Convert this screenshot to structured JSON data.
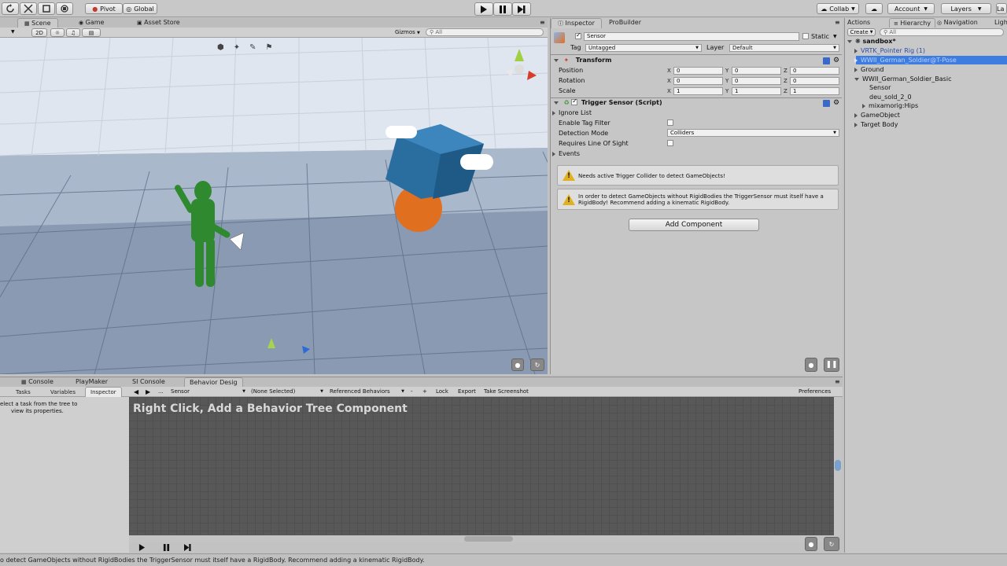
{
  "toolbar": {
    "pivot": "Pivot",
    "global": "Global",
    "collab": "Collab",
    "account": "Account",
    "layers": "Layers",
    "layout_cut": "La"
  },
  "scene_tabs": {
    "scene": "Scene",
    "game": "Game",
    "asset_store": "Asset Store",
    "mode_2d": "2D",
    "gizmos": "Gizmos",
    "search": "All"
  },
  "inspector_tabs": {
    "inspector": "Inspector",
    "probuilder": "ProBuilder"
  },
  "inspector": {
    "object_name": "Sensor",
    "static": "Static",
    "tag_label": "Tag",
    "tag_value": "Untagged",
    "layer_label": "Layer",
    "layer_value": "Default",
    "transform": {
      "title": "Transform",
      "position_label": "Position",
      "rotation_label": "Rotation",
      "scale_label": "Scale",
      "x": "X",
      "y": "Y",
      "z": "Z",
      "position": [
        "0",
        "0",
        "0"
      ],
      "rotation": [
        "0",
        "0",
        "0"
      ],
      "scale": [
        "1",
        "1",
        "1"
      ]
    },
    "trigger": {
      "title": "Trigger Sensor (Script)",
      "ignore_list": "Ignore List",
      "enable_tag_filter": "Enable Tag Filter",
      "detection_mode_label": "Detection Mode",
      "detection_mode_value": "Colliders",
      "requires_los": "Requires Line Of Sight",
      "events": "Events"
    },
    "warning1": "Needs active Trigger Collider to detect GameObjects!",
    "warning2": "In order to detect GameObjects without RigidBodies the TriggerSensor must itself have a RigidBody! Recommend adding a kinematic RigidBody.",
    "add_component": "Add Component"
  },
  "right_tabs": {
    "actions": "Actions",
    "hierarchy": "Hierarchy",
    "navigation": "Navigation",
    "lighting_cut": "Ligh",
    "create": "Create",
    "search": "All"
  },
  "hierarchy": {
    "scene": "sandbox*",
    "items": [
      "VRTK_Pointer Rig (1)",
      "WWII_German_Soldier@T-Pose",
      "Ground",
      "WWII_German_Soldier_Basic",
      "Sensor",
      "deu_sold_2_0",
      "mixamorig:Hips",
      "GameObject",
      "Target Body"
    ]
  },
  "bottom_tabs": {
    "console": "Console",
    "playmaker": "PlayMaker",
    "si_console": "SI Console",
    "behavior": "Behavior Desig"
  },
  "behavior": {
    "tasks": "Tasks",
    "variables": "Variables",
    "inspector": "Inspector",
    "dots": "...",
    "sensor": "Sensor",
    "none_selected": "(None Selected)",
    "referenced": "Referenced Behaviors",
    "minus": "-",
    "plus": "+",
    "lock": "Lock",
    "export": "Export",
    "screenshot": "Take Screenshot",
    "preferences": "Preferences",
    "left_hint_line1": "elect a task from the tree to",
    "left_hint_line2": "view its properties.",
    "canvas_text": "Right Click, Add a Behavior Tree Component"
  },
  "status_bar": "o detect GameObjects without RigidBodies the TriggerSensor must itself have a RigidBody. Recommend adding a kinematic RigidBody."
}
